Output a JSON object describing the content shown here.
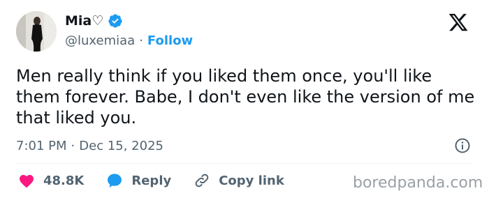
{
  "author": {
    "display_name": "Mia♡",
    "handle": "@luxemiaa",
    "separator": "·",
    "follow_label": "Follow",
    "verified_color": "#1d9bf0"
  },
  "tweet": {
    "text": "Men really think if you liked them once, you'll like them forever. Babe, I don't even like the version of me that liked you.",
    "time": "7:01 PM",
    "separator": "·",
    "date": "Dec 15, 2025"
  },
  "actions": {
    "like_count": "48.8K",
    "reply_label": "Reply",
    "copy_label": "Copy link"
  },
  "watermark": "boredpanda.com",
  "icons": [
    "x-logo-icon",
    "verified-badge-icon",
    "info-icon",
    "heart-icon",
    "reply-bubble-icon",
    "link-icon"
  ],
  "colors": {
    "accent": "#1d9bf0",
    "like": "#f91880",
    "text": "#0f1419",
    "secondary": "#536471"
  }
}
